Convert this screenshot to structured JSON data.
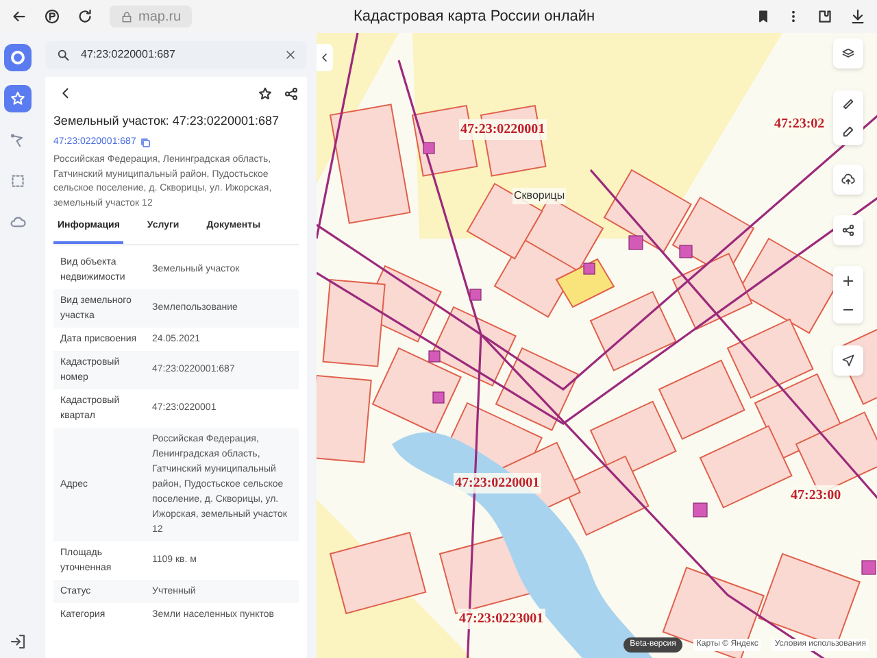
{
  "browser": {
    "url": "map.ru",
    "title": "Кадастровая карта России онлайн"
  },
  "rail": [
    {
      "kind": "favorites",
      "selected": true
    },
    {
      "kind": "route",
      "selected": false
    },
    {
      "kind": "area",
      "selected": false
    },
    {
      "kind": "cloud",
      "selected": false
    }
  ],
  "search": {
    "value": "47:23:0220001:687"
  },
  "card": {
    "title": "Земельный участок: 47:23:0220001:687",
    "link": "47:23:0220001:687",
    "address": "Российская Федерация, Ленинградская область, Гатчинский муниципальный район, Пудостьское сельское поселение, д. Скворицы, ул. Ижорская, земельный участок 12",
    "tabs": [
      {
        "label": "Информация",
        "selected": true
      },
      {
        "label": "Услуги",
        "selected": false
      },
      {
        "label": "Документы",
        "selected": false
      }
    ],
    "rows": [
      {
        "label": "Вид объекта недвижимости",
        "value": "Земельный участок"
      },
      {
        "label": "Вид земельного участка",
        "value": "Землепользование"
      },
      {
        "label": "Дата присвоения",
        "value": "24.05.2021"
      },
      {
        "label": "Кадастровый номер",
        "value": "47:23:0220001:687"
      },
      {
        "label": "Кадастровый квартал",
        "value": "47:23:0220001"
      },
      {
        "label": "Адрес",
        "value": "Российская Федерация, Ленинградская область, Гатчинский муниципальный район, Пудостьское сельское поселение, д. Скворицы, ул. Ижорская, земельный участок 12"
      },
      {
        "label": "Площадь уточненная",
        "value": "1109 кв. м"
      },
      {
        "label": "Статус",
        "value": "Учтенный"
      },
      {
        "label": "Категория",
        "value": "Земли населенных пунктов"
      }
    ]
  },
  "map": {
    "labels": [
      {
        "text": "47:23:0220001",
        "kind": "quarter"
      },
      {
        "text": "47:23:02",
        "kind": "quarter"
      },
      {
        "text": "Скворицы",
        "kind": "place"
      },
      {
        "text": "47:23:0220001",
        "kind": "quarter"
      },
      {
        "text": "47:23:00",
        "kind": "quarter"
      },
      {
        "text": "47:23:0223001",
        "kind": "quarter"
      }
    ],
    "badge": "Beta-версия",
    "copyright": "Карты © Яндекс",
    "terms": "Условия использования"
  }
}
